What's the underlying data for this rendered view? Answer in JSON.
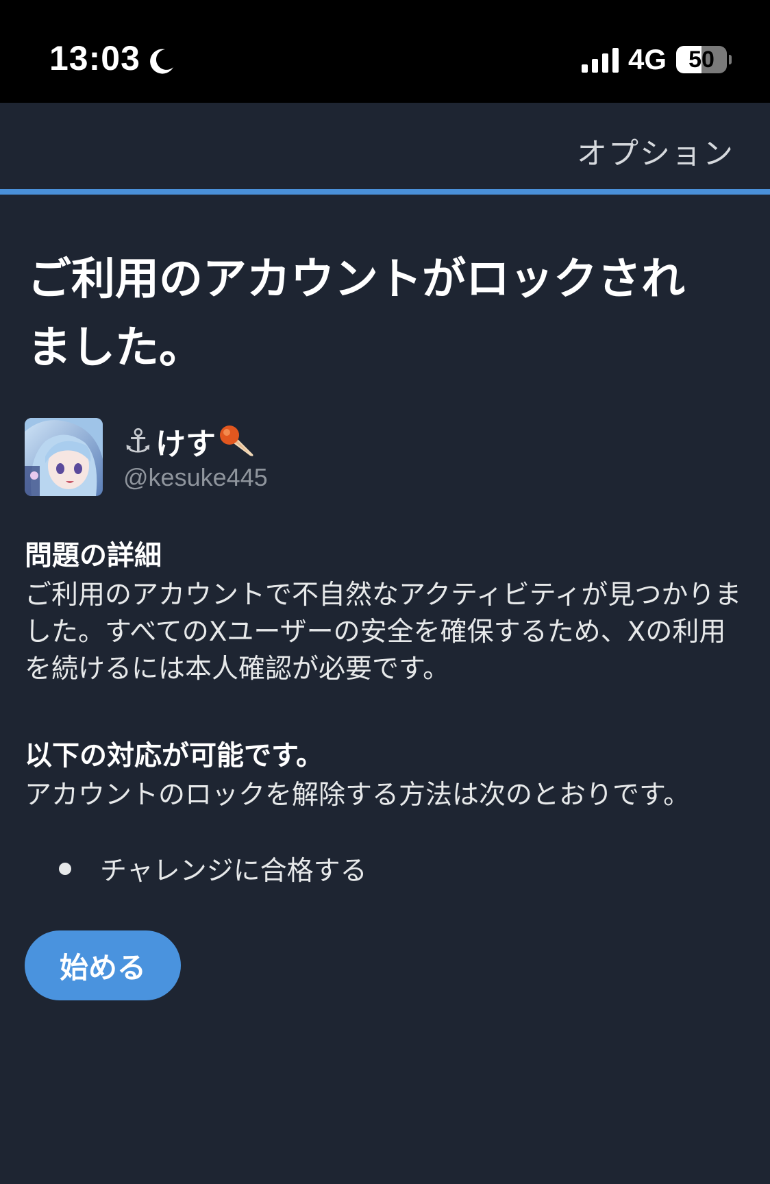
{
  "status_bar": {
    "time": "13:03",
    "moon_icon": "moon-icon",
    "network": "4G",
    "battery": "50",
    "battery_fraction": 0.5
  },
  "header": {
    "options_label": "オプション",
    "progress_fraction": 1.0,
    "progress_color": "#4a90d9"
  },
  "title": "ご利用のアカウントがロックされました。",
  "account": {
    "display_name": "けす",
    "handle": "@kesuke445",
    "prefix_icon": "anchor-icon",
    "suffix_icon": "meteor-icon"
  },
  "details": {
    "heading": "問題の詳細",
    "body": "ご利用のアカウントで不自然なアクティビティが見つかりました。すべてのXユーザーの安全を確保するため、Xの利用を続けるには本人確認が必要です。"
  },
  "options": {
    "heading": "以下の対応が可能です。",
    "body": "アカウントのロックを解除する方法は次のとおりです。",
    "items": [
      "チャレンジに合格する"
    ]
  },
  "start_button": {
    "label": "始める",
    "color": "#4a93de"
  }
}
